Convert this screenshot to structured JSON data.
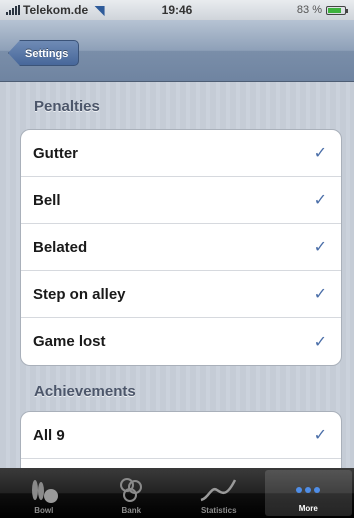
{
  "status_bar": {
    "carrier": "Telekom.de",
    "time": "19:46",
    "battery_text": "83 %",
    "battery_level": 0.83
  },
  "nav": {
    "back_label": "Settings"
  },
  "sections": [
    {
      "title": "Penalties",
      "items": [
        {
          "label": "Gutter",
          "checked": true
        },
        {
          "label": "Bell",
          "checked": true
        },
        {
          "label": "Belated",
          "checked": true
        },
        {
          "label": "Step on alley",
          "checked": true
        },
        {
          "label": "Game lost",
          "checked": true
        }
      ]
    },
    {
      "title": "Achievements",
      "items": [
        {
          "label": "All 9",
          "checked": true
        },
        {
          "label": "",
          "checked": false
        }
      ]
    }
  ],
  "tabs": [
    {
      "label": "Bowl",
      "icon": "pins-icon",
      "active": false
    },
    {
      "label": "Bank",
      "icon": "coins-icon",
      "active": false
    },
    {
      "label": "Statistics",
      "icon": "graph-icon",
      "active": false
    },
    {
      "label": "More",
      "icon": "more-dots-icon",
      "active": true
    }
  ],
  "check_glyph": "✓",
  "colors": {
    "nav_tint": "#7a8ea9",
    "check": "#4a6ea8",
    "tabbar": "#1a1a1a"
  }
}
